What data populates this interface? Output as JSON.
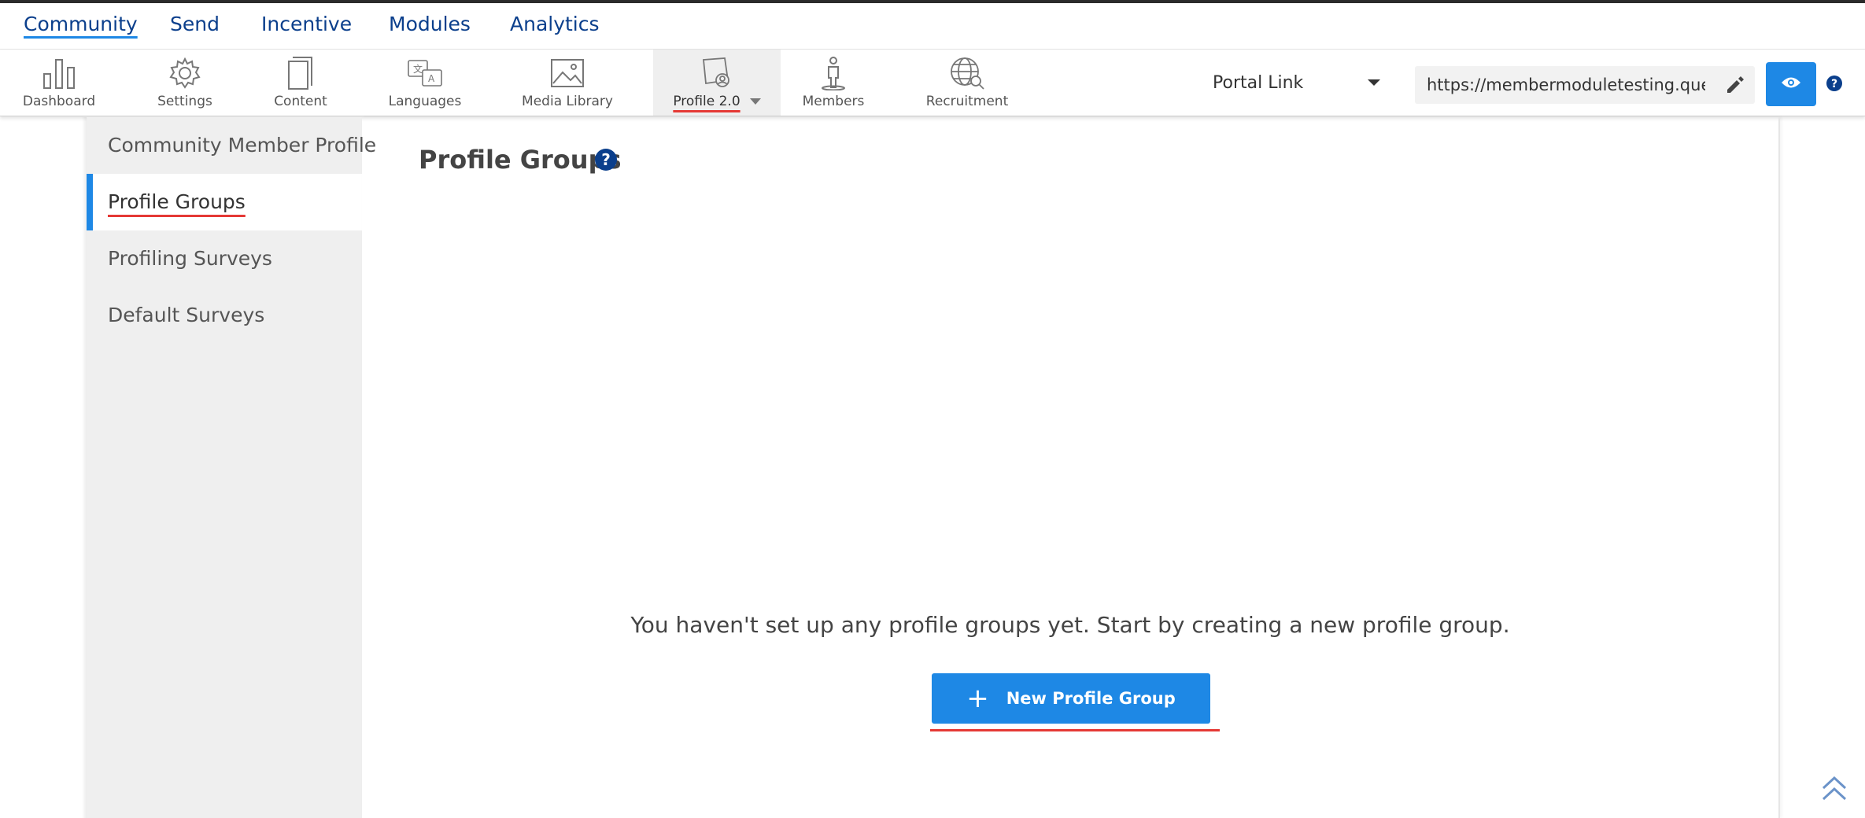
{
  "main_nav": {
    "items": [
      {
        "label": "Community",
        "active": true
      },
      {
        "label": "Send",
        "active": false
      },
      {
        "label": "Incentive",
        "active": false
      },
      {
        "label": "Modules",
        "active": false
      },
      {
        "label": "Analytics",
        "active": false
      }
    ]
  },
  "toolbar": {
    "items": [
      {
        "label": "Dashboard",
        "icon": "bar-chart-icon"
      },
      {
        "label": "Settings",
        "icon": "gear-icon"
      },
      {
        "label": "Content",
        "icon": "document-icon"
      },
      {
        "label": "Languages",
        "icon": "translate-icon"
      },
      {
        "label": "Media Library",
        "icon": "image-icon"
      },
      {
        "label": "Profile 2.0",
        "icon": "profile-card-icon",
        "active": true
      },
      {
        "label": "Members",
        "icon": "person-icon"
      },
      {
        "label": "Recruitment",
        "icon": "globe-search-icon"
      }
    ],
    "portal_select": {
      "value": "Portal Link"
    },
    "url": {
      "value": "https://membermoduletesting.questionpro.com"
    }
  },
  "sidebar": {
    "items": [
      {
        "label": "Community Member Profile",
        "active": false
      },
      {
        "label": "Profile Groups",
        "active": true
      },
      {
        "label": "Profiling Surveys",
        "active": false
      },
      {
        "label": "Default Surveys",
        "active": false
      }
    ]
  },
  "main": {
    "title": "Profile Groups",
    "empty_message": "You haven't set up any profile groups yet. Start by creating a new profile group.",
    "new_button": {
      "icon": "+",
      "label": "New Profile Group"
    }
  },
  "colors": {
    "accent": "#1e88e5",
    "nav_text": "#0b3f8c",
    "highlight_underline": "#e53935",
    "sidebar_bg": "#efefef"
  }
}
